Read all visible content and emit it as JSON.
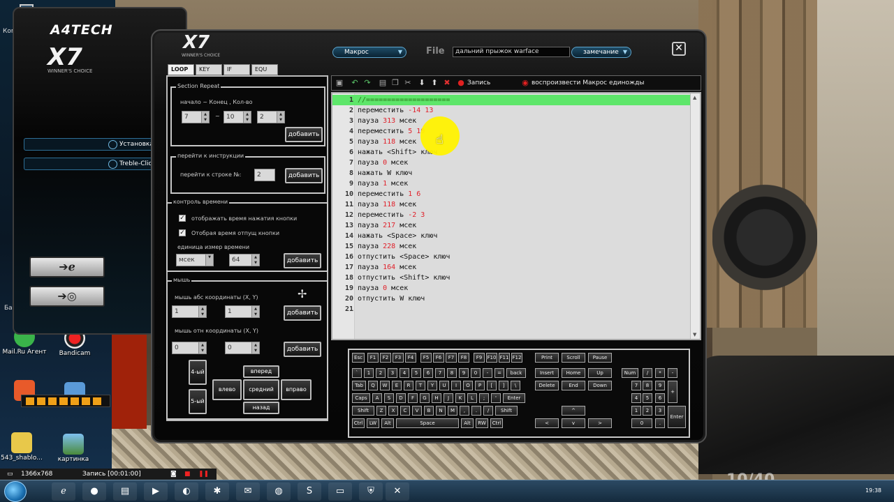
{
  "desktop": {
    "icons": [
      {
        "label": "Mail.Ru Агент"
      },
      {
        "label": "Bandicam"
      },
      {
        "label": "543_shablo..."
      },
      {
        "label": "картинка"
      }
    ],
    "left_edge_labels": {
      "computer": "Компь",
      "b_label": "Ба"
    },
    "ammo": "10/40"
  },
  "back_window": {
    "brand": "A4TECH",
    "logo": "X7",
    "tagline": "WINNER'S CHOICE",
    "item_install": "Установка",
    "item_treble": "Treble-Click"
  },
  "editor": {
    "logo": "X7",
    "tagline": "WINNER'S CHOICE",
    "macro_pill": "Макрос",
    "file_label": "File",
    "file_value": "дальний прыжок warface",
    "note_pill": "замечание",
    "close_glyph": "✕",
    "tabs": [
      "LOOP",
      "KEY",
      "IF",
      "EQU"
    ],
    "section_repeat": {
      "title": "Section Repeat",
      "hint": "начало ~ Конец , Кол-во",
      "start": "7",
      "sep": "~",
      "end": "10",
      "count": "2",
      "add": "добавить"
    },
    "goto": {
      "title": "перейти к инструкции",
      "label": "перейти к строке №:",
      "value": "2",
      "add": "добавить"
    },
    "time_control": {
      "title": "контроль времени",
      "opt1": "отображать время нажатия кнопки",
      "opt2": "Отобрая время отпущ кнопки",
      "unit_label": "единица измер времени",
      "unit": "мсек",
      "value": "64",
      "add": "добавить"
    },
    "mouse": {
      "title": "мышь",
      "abs_label": "мышь абс координаты (X, Y)",
      "abs_x": "1",
      "abs_y": "1",
      "rel_label": "мышь отн координаты (X, Y)",
      "rel_x": "0",
      "rel_y": "0",
      "add": "добавить",
      "btn_4": "4-ый",
      "btn_5": "5-ый",
      "forward": "вперед",
      "left": "влево",
      "middle": "средний",
      "right": "вправо",
      "back": "назад"
    },
    "toolbar": {
      "record": "Запись",
      "play_once": "воспроизвести Макрос единожды"
    },
    "script_lines": [
      {
        "n": "1",
        "text": "//====================",
        "num": ""
      },
      {
        "n": "2",
        "text": "переместить ",
        "num": "-14 13"
      },
      {
        "n": "3",
        "text": "пауза ",
        "num": "313",
        "tail": " мсек"
      },
      {
        "n": "4",
        "text": "переместить ",
        "num": "5 10"
      },
      {
        "n": "5",
        "text": "пауза ",
        "num": "118",
        "tail": " мсек"
      },
      {
        "n": "6",
        "text": "нажать <Shift> ключ",
        "num": ""
      },
      {
        "n": "7",
        "text": "пауза ",
        "num": "0",
        "tail": " мсек"
      },
      {
        "n": "8",
        "text": "нажать W ключ",
        "num": ""
      },
      {
        "n": "9",
        "text": "пауза ",
        "num": "1",
        "tail": " мсек"
      },
      {
        "n": "10",
        "text": "переместить ",
        "num": "1 6"
      },
      {
        "n": "11",
        "text": "пауза ",
        "num": "118",
        "tail": " мсек"
      },
      {
        "n": "12",
        "text": "переместить ",
        "num": "-2 3"
      },
      {
        "n": "13",
        "text": "пауза ",
        "num": "217",
        "tail": " мсек"
      },
      {
        "n": "14",
        "text": "нажать <Space> ключ",
        "num": ""
      },
      {
        "n": "15",
        "text": "пауза ",
        "num": "228",
        "tail": " мсек"
      },
      {
        "n": "16",
        "text": "отпустить <Space> ключ",
        "num": ""
      },
      {
        "n": "17",
        "text": "пауза ",
        "num": "164",
        "tail": " мсек"
      },
      {
        "n": "18",
        "text": "отпустить <Shift> ключ",
        "num": ""
      },
      {
        "n": "19",
        "text": "пауза ",
        "num": "0",
        "tail": " мсек"
      },
      {
        "n": "20",
        "text": "отпустить W ключ",
        "num": ""
      },
      {
        "n": "21",
        "text": "",
        "num": ""
      }
    ],
    "keyboard": {
      "row_f": [
        "Esc",
        "F1",
        "F2",
        "F3",
        "F4",
        "F5",
        "F6",
        "F7",
        "F8",
        "F9",
        "F10",
        "F11",
        "F12"
      ],
      "row_sys": [
        "Print",
        "Scroll",
        "Pause"
      ],
      "row_num": [
        "`",
        "1",
        "2",
        "3",
        "4",
        "5",
        "6",
        "7",
        "8",
        "9",
        "0",
        "-",
        "=",
        "back"
      ],
      "row_tab": [
        "Tab",
        "Q",
        "W",
        "E",
        "R",
        "T",
        "Y",
        "U",
        "I",
        "O",
        "P",
        "[",
        "]",
        "\\"
      ],
      "row_caps": [
        "Caps",
        "A",
        "S",
        "D",
        "F",
        "G",
        "H",
        "J",
        "K",
        "L",
        ";",
        "'",
        "Enter"
      ],
      "row_shift": [
        "Shift",
        "Z",
        "X",
        "C",
        "V",
        "B",
        "N",
        "M",
        ",",
        ".",
        "/",
        "Shift"
      ],
      "row_ctrl": [
        "Ctrl",
        "LW",
        "Alt",
        "Space",
        "Alt",
        "RW",
        "Ctrl"
      ],
      "nav1": [
        "Insert",
        "Home",
        "Up"
      ],
      "nav2": [
        "Delete",
        "End",
        "Down"
      ],
      "arrows": [
        "^",
        "<",
        "v",
        ">"
      ],
      "numpad": [
        "Num",
        "/",
        "*",
        "-",
        "7",
        "8",
        "9",
        "+",
        "4",
        "5",
        "6",
        "1",
        "2",
        "3",
        "Enter",
        "0",
        "."
      ]
    }
  },
  "recorder_bar": {
    "resolution": "1366x768",
    "status": "Запись [00:01:00]"
  },
  "taskbar": {
    "clock": "19:38"
  }
}
